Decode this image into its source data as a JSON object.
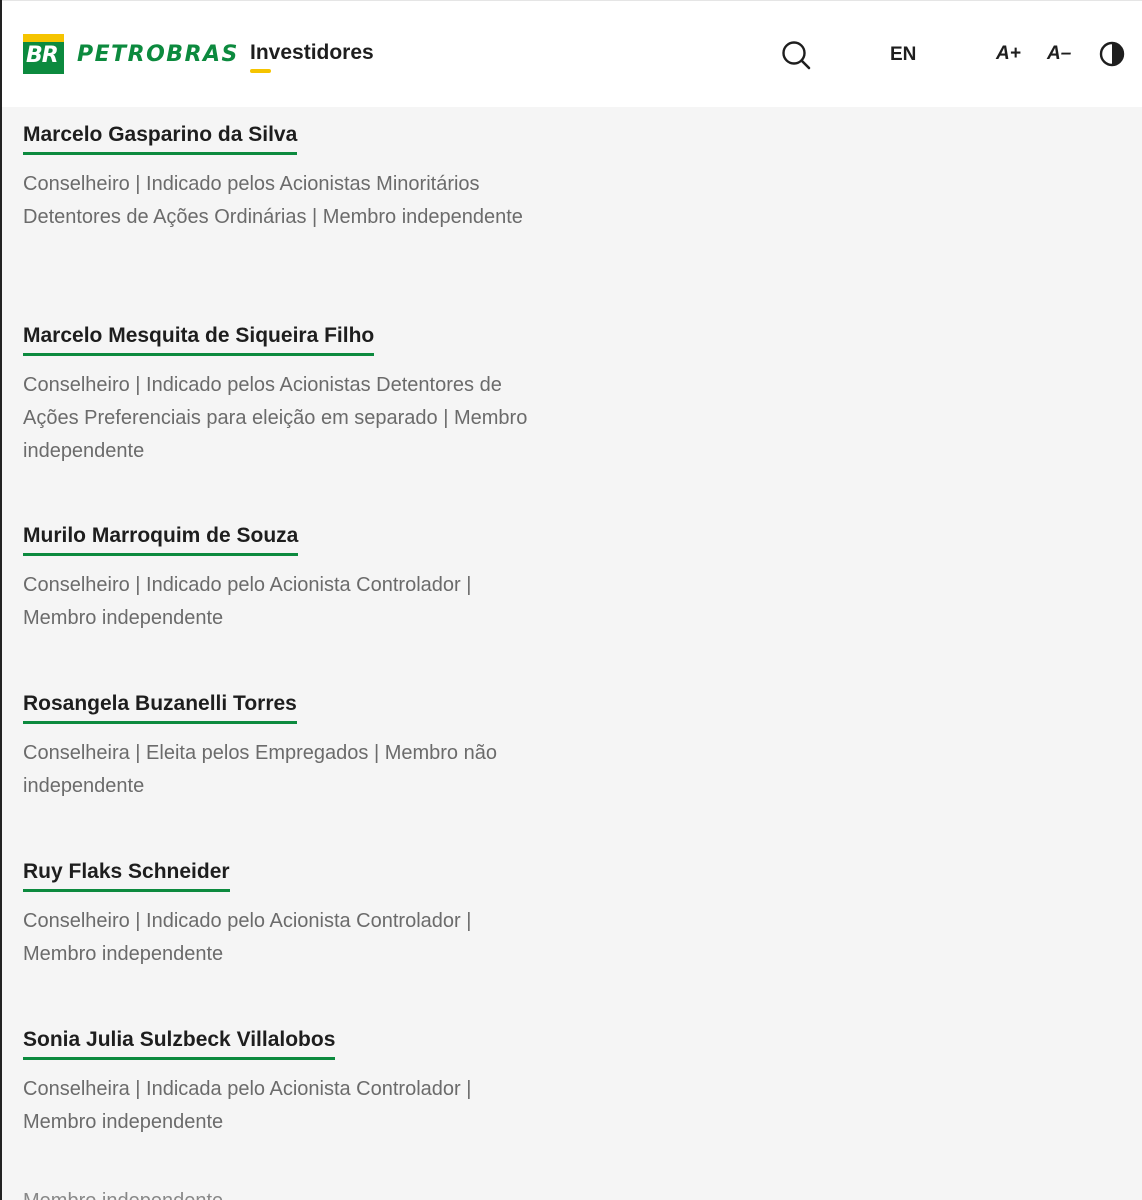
{
  "header": {
    "logo_badge": "BR",
    "brand": "PETROBRAS",
    "nav_label": "Investidores",
    "language": "EN",
    "font_increase": "A+",
    "font_decrease": "A–",
    "colors": {
      "brand_green": "#0c8a3e",
      "brand_yellow": "#f5c400"
    }
  },
  "members": [
    {
      "name": "Marcelo Gasparino da Silva",
      "role": "Conselheiro | Indicado pelos Acionistas Minoritários Detentores de Ações Ordinárias | Membro independente"
    },
    {
      "name": "Marcelo Mesquita de Siqueira Filho",
      "role": "Conselheiro | Indicado pelos Acionistas Detentores de Ações Preferenciais para eleição em separado | Membro independente"
    },
    {
      "name": "Murilo Marroquim de Souza",
      "role": "Conselheiro | Indicado pelo Acionista Controlador | Membro independente"
    },
    {
      "name": "Rosangela Buzanelli Torres",
      "role": "Conselheira | Eleita pelos Empregados | Membro não independente"
    },
    {
      "name": "Ruy Flaks Schneider",
      "role": "Conselheiro | Indicado pelo Acionista Controlador | Membro independente"
    },
    {
      "name": "Sonia Julia Sulzbeck Villalobos",
      "role": "Conselheira | Indicada pelo Acionista Controlador | Membro independente"
    }
  ],
  "cutoff_text": "Membro independente"
}
